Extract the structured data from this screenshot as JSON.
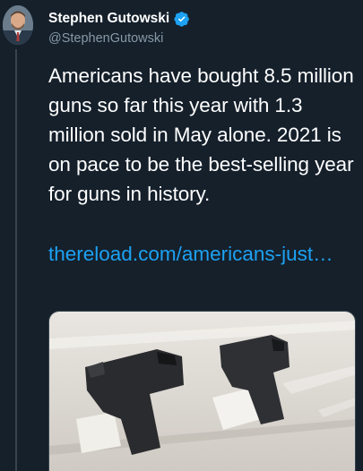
{
  "author": {
    "display_name": "Stephen Gutowski",
    "handle": "@StephenGutowski",
    "verified": true
  },
  "tweet": {
    "text": "Americans have bought 8.5 million guns so far this year with 1.3 million sold in May alone. 2021 is on pace to be the best-selling year for guns in history.",
    "link_text": "thereload.com/americans-just…"
  },
  "media": {
    "description_icon": "photo-icon"
  },
  "colors": {
    "background": "#15202b",
    "text": "#ffffff",
    "secondary_text": "#8899a6",
    "link": "#1da1f2",
    "verified": "#1da1f2",
    "thread_line": "#38444d"
  }
}
